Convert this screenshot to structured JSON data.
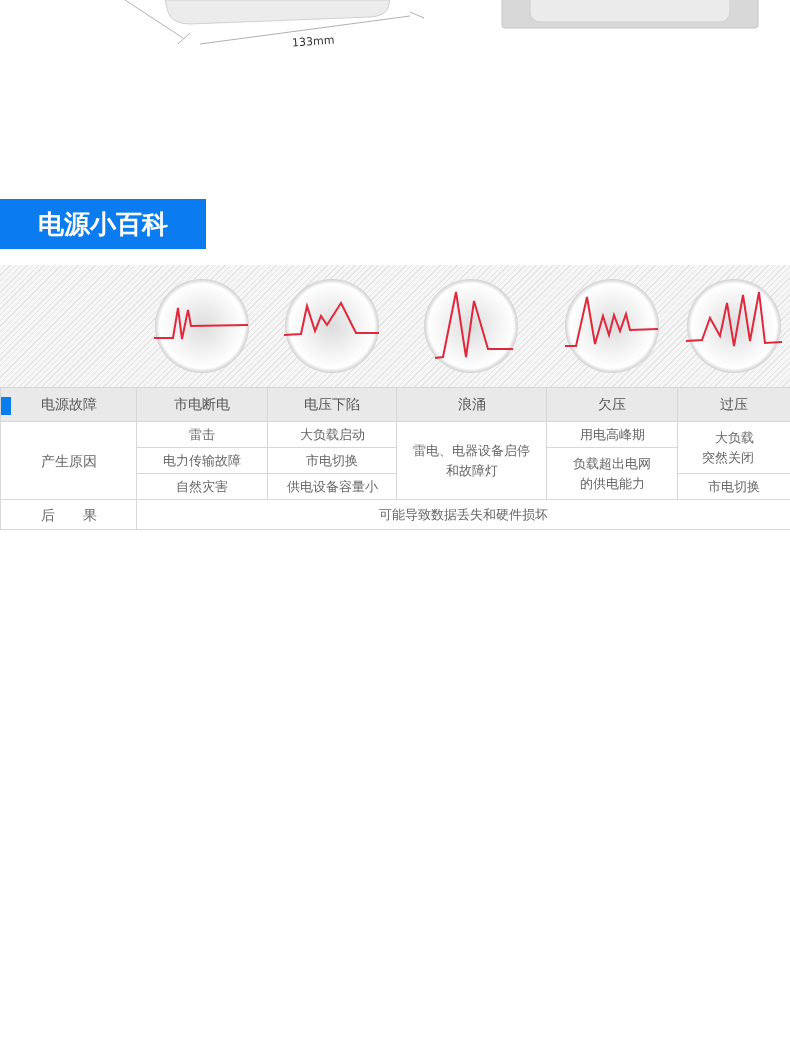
{
  "product_image": {
    "dimension_label": "133mm"
  },
  "banner": {
    "title": "电源小百科"
  },
  "table": {
    "corner": "电源故障",
    "columns": [
      {
        "header": "市电断电",
        "causes": [
          {
            "text": "雷击",
            "kind": "single"
          },
          {
            "text": "电力传输故障",
            "kind": "single"
          },
          {
            "text": "自然灾害",
            "kind": "single"
          }
        ]
      },
      {
        "header": "电压下陷",
        "causes": [
          {
            "text": "大负载启动",
            "kind": "single"
          },
          {
            "text": "市电切换",
            "kind": "single"
          },
          {
            "text": "供电设备容量小",
            "kind": "single"
          }
        ]
      },
      {
        "header": "浪涌",
        "causes": [
          {
            "text": "雷电、电器设备启停和故障灯",
            "kind": "triple"
          }
        ]
      },
      {
        "header": "欠压",
        "causes": [
          {
            "text": "用电高峰期",
            "kind": "single"
          },
          {
            "text": "负载超出电网的供电能力",
            "kind": "double"
          }
        ]
      },
      {
        "header": "过压",
        "causes": [
          {
            "text": "大负载突然关闭",
            "kind": "double"
          },
          {
            "text": "市电切换",
            "kind": "single"
          }
        ]
      }
    ],
    "cause_label": "产生原因",
    "result_label": "后　　果",
    "result": "可能导致数据丢失和硬件损坏"
  }
}
